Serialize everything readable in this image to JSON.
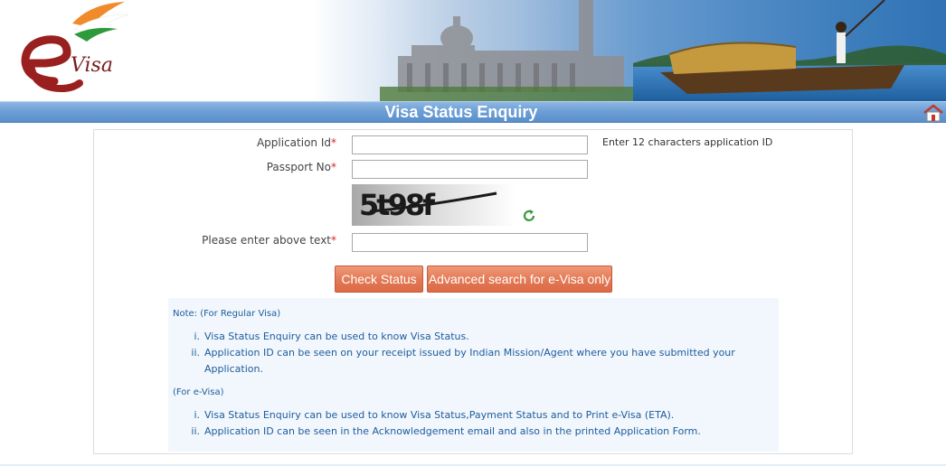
{
  "banner": {
    "logo_text": "Visa",
    "logo_letter": "e"
  },
  "titlebar": {
    "title": "Visa Status Enquiry",
    "home_icon": "home-icon"
  },
  "form": {
    "application_id": {
      "label": "Application Id",
      "required_mark": "*",
      "value": "",
      "hint": "Enter 12 characters application ID"
    },
    "passport_no": {
      "label": "Passport No",
      "required_mark": "*",
      "value": ""
    },
    "captcha": {
      "image_text": "5t98f",
      "refresh_icon": "refresh-icon"
    },
    "captcha_input": {
      "label": "Please enter above text",
      "required_mark": "*",
      "value": ""
    },
    "buttons": {
      "check_status": "Check Status",
      "advanced_search": "Advanced search for e-Visa only"
    }
  },
  "notes": {
    "regular_header": "Note: (For Regular Visa)",
    "regular_items": [
      {
        "num": "i.",
        "text": "Visa Status Enquiry can be used to know Visa Status."
      },
      {
        "num": "ii.",
        "text": "Application ID can be seen on your receipt issued by Indian Mission/Agent where you have submitted your"
      },
      {
        "num": "",
        "text": "Application."
      }
    ],
    "evisa_header": "(For e-Visa)",
    "evisa_items": [
      {
        "num": "i.",
        "text": "Visa Status Enquiry can be used to know Visa Status,Payment Status and to Print e-Visa (ETA)."
      },
      {
        "num": "ii.",
        "text": "Application ID can be seen in the Acknowledgement email and also in the printed Application Form."
      }
    ]
  },
  "colors": {
    "title_bar": "#6d9fd6",
    "button": "#e47a57",
    "note_text": "#1d5c9c",
    "required": "#dd2222"
  }
}
